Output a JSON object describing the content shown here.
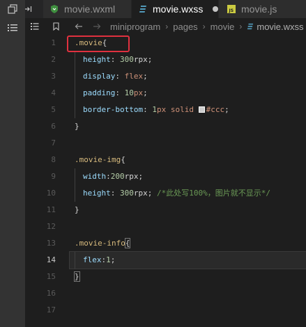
{
  "tabs": [
    {
      "label": "movie.wxml",
      "icon": "wxml-file-icon",
      "active": false
    },
    {
      "label": "movie.wxss",
      "icon": "css-file-icon",
      "active": true,
      "modified": true
    },
    {
      "label": "movie.js",
      "icon": "js-file-icon",
      "active": false
    }
  ],
  "breadcrumb": [
    "miniprogram",
    "pages",
    "movie",
    "movie.wxss"
  ],
  "line_numbers": [
    "1",
    "2",
    "3",
    "4",
    "5",
    "6",
    "7",
    "8",
    "9",
    "10",
    "11",
    "12",
    "13",
    "14",
    "15",
    "16",
    "17"
  ],
  "code": {
    "l1": {
      "selector": ".movie",
      "brace": "{"
    },
    "l2": {
      "prop": "height",
      "colon": ": ",
      "num": "300",
      "unit": "rpx",
      "semi": ";"
    },
    "l3": {
      "prop": "display",
      "colon": ": ",
      "value": "flex",
      "semi": ";"
    },
    "l4": {
      "prop": "padding",
      "colon": ": ",
      "num": "10",
      "unit": "px",
      "semi": ";"
    },
    "l5": {
      "prop": "border-bottom",
      "colon": ": ",
      "num": "1",
      "unit": "px",
      "style": " solid ",
      "color": "#ccc",
      "semi": ";"
    },
    "l6": {
      "brace": "}"
    },
    "l8": {
      "selector": ".movie-img",
      "brace": "{"
    },
    "l9": {
      "prop": "width",
      "colon": ":",
      "num": "200",
      "unit": "rpx",
      "semi": ";"
    },
    "l10": {
      "prop": "height",
      "colon": ": ",
      "num": "300",
      "unit": "rpx",
      "semi": "; ",
      "comment": "/*此处写100%，图片就不显示*/"
    },
    "l11": {
      "brace": "}"
    },
    "l13": {
      "selector": ".movie-info",
      "brace": "{"
    },
    "l14": {
      "prop": "flex",
      "colon": ":",
      "num": "1",
      "semi": ";"
    },
    "l15": {
      "brace": "}"
    }
  },
  "colors": {
    "swatch": "#cccccc",
    "highlight": "#e0313f",
    "accent": "#519aba"
  },
  "current_line": 14
}
